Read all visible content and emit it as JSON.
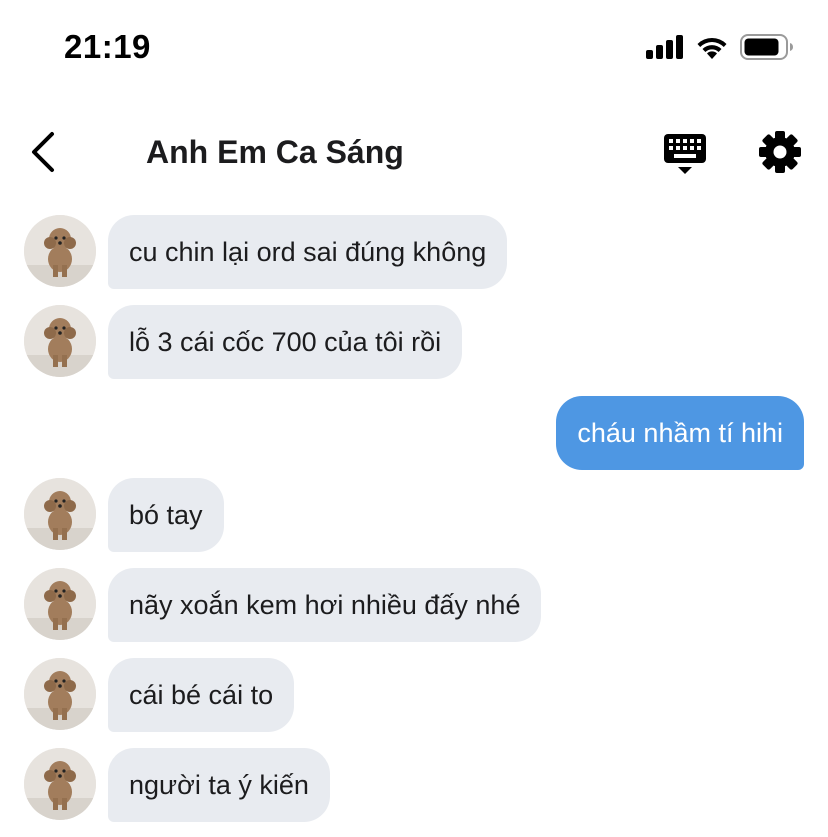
{
  "status_bar": {
    "time": "21:19",
    "icons": [
      "cellular-signal-icon",
      "wifi-icon",
      "battery-icon"
    ]
  },
  "header": {
    "title": "Anh Em Ca Sáng",
    "back_icon": "chevron-left-icon",
    "keyboard_icon": "keyboard-icon",
    "settings_icon": "gear-icon"
  },
  "colors": {
    "incoming_bubble": "#e8ebf0",
    "outgoing_bubble": "#4e97e3",
    "text": "#1c1c1e"
  },
  "messages": [
    {
      "direction": "incoming",
      "text": "cu chin lại ord sai đúng không"
    },
    {
      "direction": "incoming",
      "text": "lỗ 3 cái cốc 700 của tôi rồi"
    },
    {
      "direction": "outgoing",
      "text": "cháu nhầm tí hihi"
    },
    {
      "direction": "incoming",
      "text": "bó tay"
    },
    {
      "direction": "incoming",
      "text": "nãy xoắn kem hơi nhiều đấy nhé"
    },
    {
      "direction": "incoming",
      "text": "cái bé cái to"
    },
    {
      "direction": "incoming",
      "text": "người ta ý kiến"
    }
  ]
}
